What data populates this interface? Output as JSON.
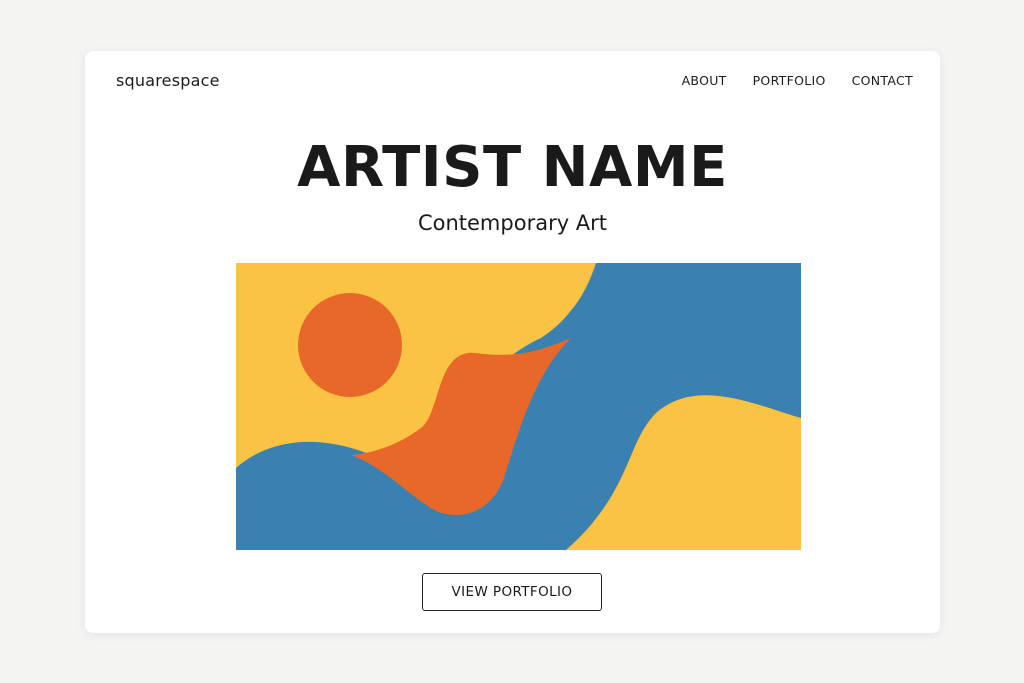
{
  "header": {
    "brand": "squarespace",
    "nav": [
      {
        "label": "ABOUT"
      },
      {
        "label": "PORTFOLIO"
      },
      {
        "label": "CONTACT"
      }
    ]
  },
  "hero": {
    "title": "ARTIST NAME",
    "subtitle": "Contemporary Art",
    "cta_label": "VIEW PORTFOLIO"
  },
  "artwork": {
    "colors": {
      "yellow": "#fbc343",
      "blue": "#3a80b0",
      "orange": "#e8682a"
    }
  }
}
